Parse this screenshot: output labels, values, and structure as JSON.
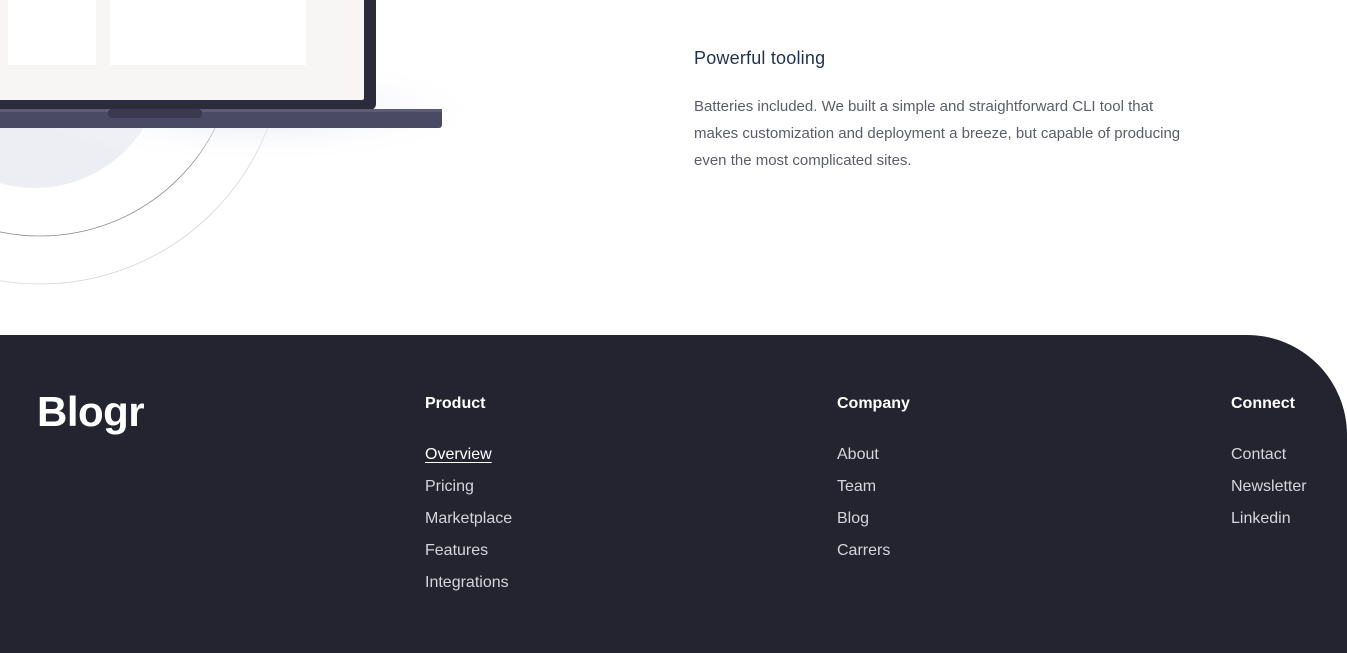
{
  "feature": {
    "title": "Powerful tooling",
    "body": "Batteries included. We built a simple and straightforward CLI tool that makes customization and deployment a breeze, but capable of producing even the most complicated sites."
  },
  "footer": {
    "logo": "Blogr",
    "columns": [
      {
        "heading": "Product",
        "links": [
          "Overview",
          "Pricing",
          "Marketplace",
          "Features",
          "Integrations"
        ]
      },
      {
        "heading": "Company",
        "links": [
          "About",
          "Team",
          "Blog",
          "Carrers"
        ]
      },
      {
        "heading": "Connect",
        "links": [
          "Contact",
          "Newsletter",
          "Linkedin"
        ]
      }
    ],
    "active_link": "Overview"
  },
  "colors": {
    "footer_bg": "#232430",
    "heading": "#1f3251",
    "body_text": "#5b5d69",
    "laptop_frame": "#4b4a64"
  }
}
